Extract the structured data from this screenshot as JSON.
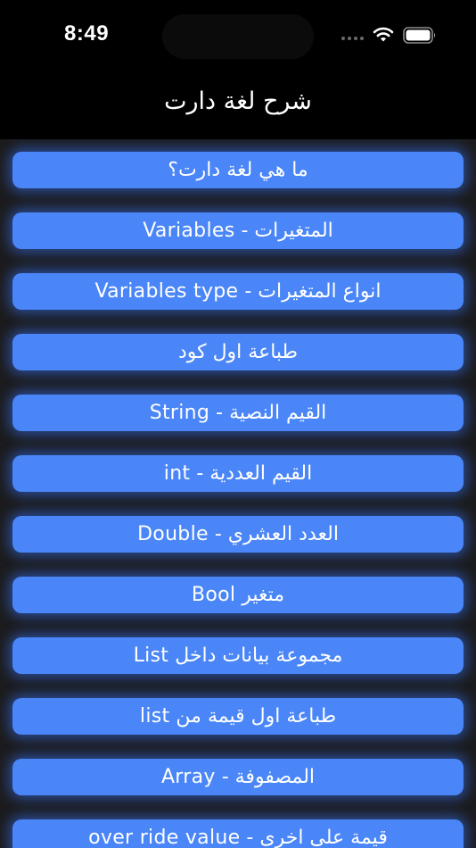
{
  "status_bar": {
    "time": "8:49"
  },
  "nav": {
    "title": "شرح لغة دارت"
  },
  "lessons": [
    "ما هي لغة دارت؟",
    "المتغيرات - Variables",
    "انواع المتغيرات  - Variables type",
    "طباعة اول كود",
    "القيم النصية - String",
    "القيم العددية - int",
    "العدد العشري - Double",
    "متغير Bool",
    "مجموعة بيانات داخل List",
    "طباعة اول قيمة من list",
    "المصفوفة - Array",
    "قيمة على اخرى - over ride value"
  ],
  "icons": {
    "signal": "cellular-signal-icon",
    "wifi": "wifi-icon",
    "battery": "battery-icon"
  },
  "colors": {
    "background": "#000000",
    "content_background": "#1c1c1e",
    "button": "#4a86f7",
    "button_glow": "#3674ff",
    "text": "#ffffff"
  }
}
